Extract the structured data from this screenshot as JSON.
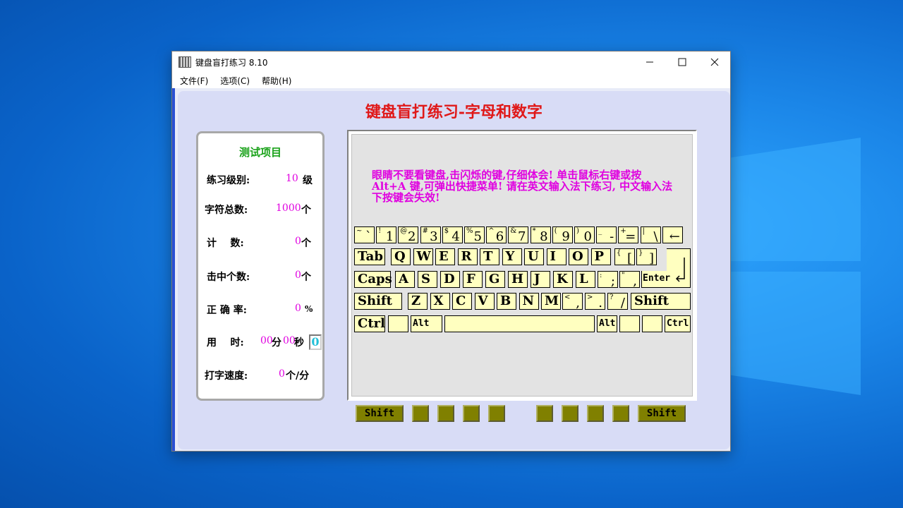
{
  "window": {
    "title": "键盘盲打练习 8.10"
  },
  "menu": [
    "文件(F)",
    "选项(C)",
    "帮助(H)"
  ],
  "main_title": "键盘盲打练习-字母和数字",
  "stats": {
    "title": "测试项目",
    "level": {
      "label": "练习级别:",
      "value": "10",
      "unit": "级"
    },
    "total": {
      "label": "字符总数:",
      "value": "1000",
      "unit": "个"
    },
    "count": {
      "label": "计    数:",
      "value": "0",
      "unit": "个"
    },
    "hits": {
      "label": "击中个数:",
      "value": "0",
      "unit": "个"
    },
    "accuracy": {
      "label": "正 确 率:",
      "value": "0",
      "unit": "%"
    },
    "time": {
      "label": "用    时:",
      "minutes": "00",
      "min_unit": "分",
      "seconds": "00",
      "sec_unit": "秒",
      "box": "0"
    },
    "speed": {
      "label": "打字速度:",
      "value": "0",
      "unit": "个/分"
    }
  },
  "hint": "    眼睛不要看键盘,击闪烁的键,仔细体会! 单击鼠标右键或按 Alt+A 键,可弹出快捷菜单! 请在英文输入法下练习, 中文输入法下按键会失效!",
  "keys": {
    "row1": [
      {
        "s": "~",
        "b": "`"
      },
      {
        "s": "!",
        "b": "1"
      },
      {
        "s": "@",
        "b": "2"
      },
      {
        "s": "#",
        "b": "3"
      },
      {
        "s": "$",
        "b": "4"
      },
      {
        "s": "%",
        "b": "5"
      },
      {
        "s": "^",
        "b": "6"
      },
      {
        "s": "&",
        "b": "7"
      },
      {
        "s": "*",
        "b": "8"
      },
      {
        "s": "(",
        "b": "9"
      },
      {
        "s": ")",
        "b": "0"
      },
      {
        "s": "_",
        "b": "-"
      },
      {
        "s": "+",
        "b": "="
      },
      {
        "s": "|",
        "b": "\\"
      },
      {
        "s": "",
        "b": "←"
      }
    ],
    "row2": [
      "Tab",
      "Q",
      "W",
      "E",
      "R",
      "T",
      "Y",
      "U",
      "I",
      "O",
      "P"
    ],
    "row2_brackets": [
      {
        "s": "{",
        "b": "["
      },
      {
        "s": "}",
        "b": "]"
      }
    ],
    "row3": [
      "Caps",
      "A",
      "S",
      "D",
      "F",
      "G",
      "H",
      "J",
      "K",
      "L"
    ],
    "row3_punct": [
      {
        "s": ":",
        "b": ";"
      },
      {
        "s": "\"",
        "b": ","
      }
    ],
    "enter": "Enter",
    "row4": [
      "Shift",
      "Z",
      "X",
      "C",
      "V",
      "B",
      "N",
      "M"
    ],
    "row4_punct": [
      {
        "s": "<",
        "b": ","
      },
      {
        "s": ">",
        "b": "."
      },
      {
        "s": "?",
        "b": "/"
      }
    ],
    "row4_shift_r": "Shift",
    "ctrl_l": "Ctrl",
    "alt_l": "Alt",
    "alt_r": "Alt",
    "ctrl_r": "Ctrl"
  },
  "finger_bar": {
    "left": "Shift",
    "right": "Shift"
  }
}
